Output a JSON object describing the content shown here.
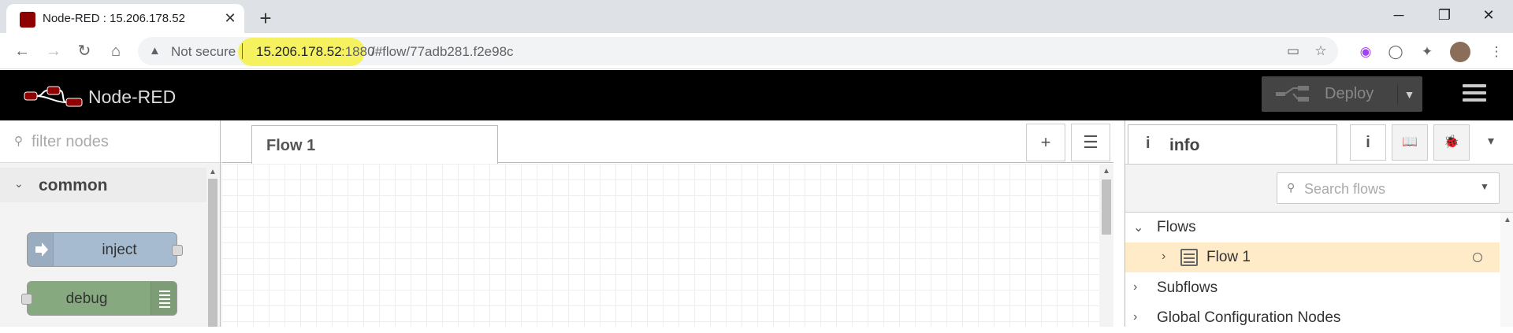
{
  "browser": {
    "tab_title": "Node-RED : 15.206.178.52",
    "close_glyph": "✕",
    "newtab_glyph": "+",
    "window_controls": [
      "─",
      "❐",
      "✕"
    ],
    "nav": {
      "back": "←",
      "forward": "→",
      "reload": "↻",
      "home": "⌂"
    },
    "address": {
      "security_label": "Not secure",
      "host": "15.206.178.52",
      "port": ":1880",
      "path": "/#flow/77adb281.f2e98c"
    }
  },
  "header": {
    "title": "Node-RED",
    "deploy_label": "Deploy",
    "deploy_caret": "▼"
  },
  "palette": {
    "filter_placeholder": "filter nodes",
    "category": {
      "label": "common",
      "chevron": "⌄"
    },
    "nodes": [
      {
        "label": "inject",
        "color": "#a6bbcf"
      },
      {
        "label": "debug",
        "color": "#87a980"
      }
    ]
  },
  "workspace": {
    "tabs": [
      {
        "label": "Flow 1"
      }
    ],
    "add_glyph": "+",
    "list_glyph": "☰"
  },
  "sidebar": {
    "tab_icon": "i",
    "tab_label": "info",
    "buttons": {
      "info": "i",
      "help": "📖",
      "debug": "🐞"
    },
    "search_placeholder": "Search flows",
    "tree": [
      {
        "label": "Flows",
        "chevron": "⌄"
      },
      {
        "label": "Flow 1",
        "chevron": "›"
      },
      {
        "label": "Subflows",
        "chevron": "›"
      },
      {
        "label": "Global Configuration Nodes",
        "chevron": "›"
      }
    ]
  },
  "colors": {
    "header_bg": "#000000",
    "selected_row": "#ffebc7",
    "url_highlight": "#f6f25f",
    "brand_red": "#8f0000"
  }
}
